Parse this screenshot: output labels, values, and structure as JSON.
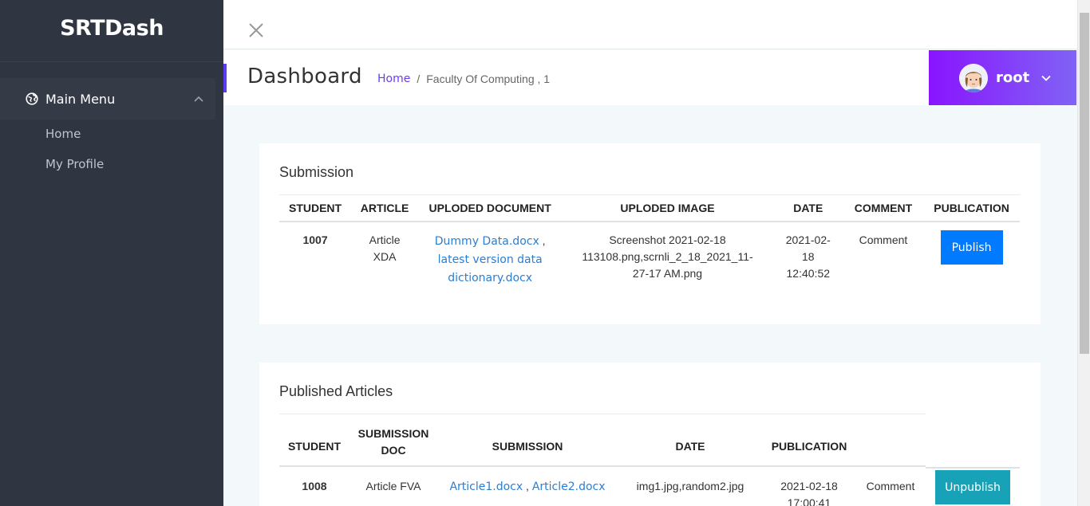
{
  "sidebar": {
    "logo": "SRTDash",
    "menu": {
      "label": "Main Menu",
      "items": [
        {
          "label": "Home"
        },
        {
          "label": "My Profile"
        }
      ]
    }
  },
  "header": {
    "page_title": "Dashboard",
    "breadcrumb": {
      "home": "Home",
      "separator": "/",
      "current": "Faculty Of Computing , 1"
    },
    "user": {
      "name": "root"
    }
  },
  "submission": {
    "title": "Submission",
    "columns": [
      "STUDENT",
      "ARTICLE",
      "UPLODED DOCUMENT",
      "UPLODED IMAGE",
      "DATE",
      "COMMENT",
      "PUBLICATION"
    ],
    "rows": [
      {
        "student": "1007",
        "article_line1": "Article",
        "article_line2": "XDA",
        "doc1": "Dummy Data.docx",
        "doc_sep": " ,",
        "doc2": "latest version data dictionary.docx",
        "image": "Screenshot 2021-02-18 113108.png,scrnli_2_18_2021_11-27-17 AM.png",
        "date_line1": "2021-02-",
        "date_line2": "18",
        "date_line3": "12:40:52",
        "comment": "Comment",
        "action": "Publish"
      }
    ]
  },
  "published": {
    "title": "Published Articles",
    "columns": [
      "STUDENT",
      "SUBMISSION DOC",
      "SUBMISSION",
      "DATE",
      "PUBLICATION"
    ],
    "rows": [
      {
        "student": "1008",
        "doc": "Article FVA",
        "sub1": "Article1.docx",
        "sub_sep": " , ",
        "sub2": "Article2.docx",
        "date": "img1.jpg,random2.jpg",
        "pub_line1": "2021-02-18",
        "pub_line2": "17:00:41",
        "comment": "Comment",
        "action": "Unpublish"
      }
    ]
  },
  "colors": {
    "sidebar_bg": "#303641",
    "accent": "#5c3cf0",
    "user_gradient_start": "#8914fe",
    "user_gradient_end": "#8063f5",
    "publish_button": "#007bff",
    "unpublish_button": "#17a2b8",
    "link": "#2a7ed3"
  }
}
